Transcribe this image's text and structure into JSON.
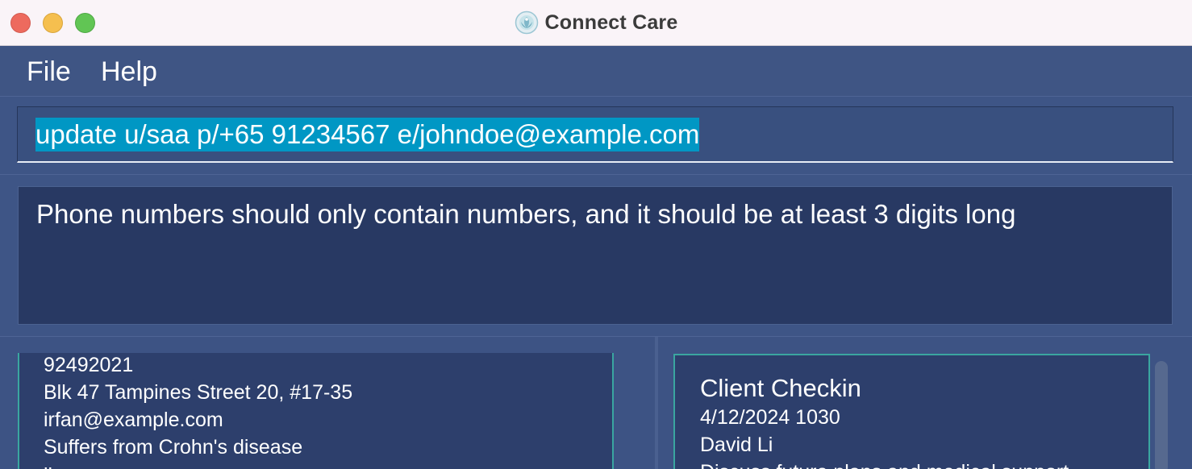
{
  "window": {
    "title": "Connect Care",
    "app_icon": "connect-care-logo-icon",
    "controls": [
      "close",
      "minimize",
      "maximize"
    ]
  },
  "menu": {
    "file": "File",
    "help": "Help"
  },
  "command": {
    "text": "update u/saa p/+65 91234567 e/johndoe@example.com"
  },
  "result": {
    "message": "Phone numbers should only contain numbers, and it should be at least 3 digits long"
  },
  "person_card": {
    "phone": "92492021",
    "address": "Blk 47 Tampines Street 20, #17-35",
    "email": "irfan@example.com",
    "note": "Suffers from Crohn's disease",
    "tag_partial": "ibs"
  },
  "appointment_card": {
    "title": "Client Checkin",
    "datetime": "4/12/2024 1030",
    "client": "David Li",
    "description": "Discuss future plans and medical support"
  },
  "colors": {
    "background": "#3a5183",
    "card_border": "#3aa6a0",
    "selection": "#0097c4",
    "result_bg": "#283963"
  }
}
